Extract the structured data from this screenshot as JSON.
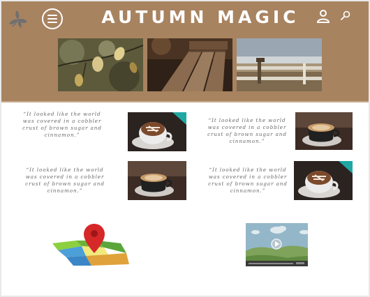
{
  "header": {
    "title": "AUTUMN MAGIC",
    "icons": [
      "leaf-logo-icon",
      "menu-icon",
      "user-icon",
      "search-icon"
    ],
    "brand_color": "#a88360"
  },
  "hero_images": [
    {
      "subject": "autumn leaves on branch"
    },
    {
      "subject": "wooden bench"
    },
    {
      "subject": "fence by the sea"
    }
  ],
  "quotes": [
    {
      "text": "“It looked like the world was covered in a cobbler crust of brown sugar and cinnamon.”",
      "image": "latte art cup"
    },
    {
      "text": "“It looked like the world was covered in a cobbler crust of brown sugar and cinnamon.”",
      "image": "coffee cup"
    },
    {
      "text": "“It looked like the world was covered in a cobbler crust of brown sugar and cinnamon.”",
      "image": "coffee cup"
    },
    {
      "text": "“It looked like the world was covered in a cobbler crust of brown sugar and cinnamon.”",
      "image": "latte art cup"
    }
  ],
  "widgets": {
    "map": "map-icon",
    "video": "video-placeholder-icon"
  }
}
